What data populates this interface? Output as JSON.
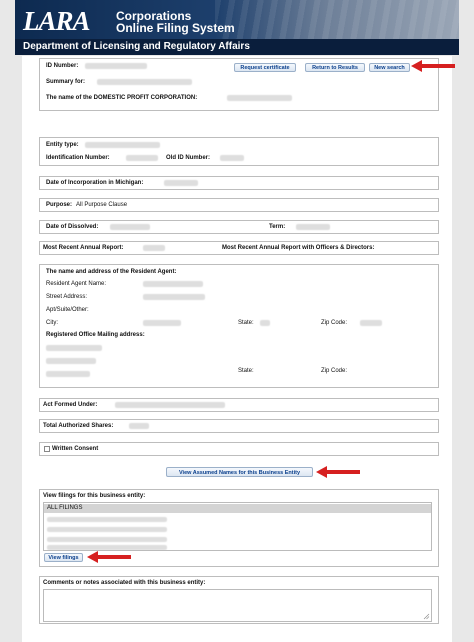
{
  "header": {
    "logo": "LARA",
    "system_line1": "Corporations",
    "system_line2": "Online Filing System",
    "department": "Department of Licensing and Regulatory Affairs"
  },
  "summary": {
    "id_number_label": "ID Number:",
    "summary_for_label": "Summary for:",
    "entity_name_label": "The name of the DOMESTIC PROFIT CORPORATION:",
    "request_certificate": "Request certificate",
    "return_to_results": "Return to Results",
    "new_search": "New search"
  },
  "entity": {
    "entity_type_label": "Entity type:",
    "identification_number_label": "Identification Number:",
    "old_id_number_label": "Old ID Number:"
  },
  "incorporation": {
    "date_label": "Date of Incorporation in Michigan:"
  },
  "purpose": {
    "label": "Purpose:",
    "value": "All Purpose Clause"
  },
  "dissolved": {
    "date_label": "Date of Dissolved:",
    "term_label": "Term:"
  },
  "annual_report": {
    "recent_label": "Most Recent Annual Report:",
    "officers_label": "Most Recent Annual Report with Officers & Directors:"
  },
  "resident_agent": {
    "title": "The name and address of the Resident Agent:",
    "name_label": "Resident Agent Name:",
    "street_label": "Street Address:",
    "apt_label": "Apt/Suite/Other:",
    "city_label": "City:",
    "state_label": "State:",
    "zip_label": "Zip Code:",
    "mailing_title": "Registered Office Mailing address:",
    "mailing_state_label": "State:",
    "mailing_zip_label": "Zip Code:"
  },
  "act": {
    "label": "Act Formed Under:"
  },
  "shares": {
    "label": "Total Authorized Shares:"
  },
  "consent": {
    "label": "Written Consent"
  },
  "assumed_names": {
    "button": "View Assumed Names for this Business Entity"
  },
  "filings": {
    "title": "View filings for this business entity:",
    "options": [
      "ALL FILINGS"
    ],
    "button": "View filings"
  },
  "comments": {
    "title": "Comments or notes associated with this business entity:"
  },
  "colors": {
    "arrow": "#d62020",
    "button_text": "#0a3f8c",
    "header_dark": "#0a1e3c"
  }
}
